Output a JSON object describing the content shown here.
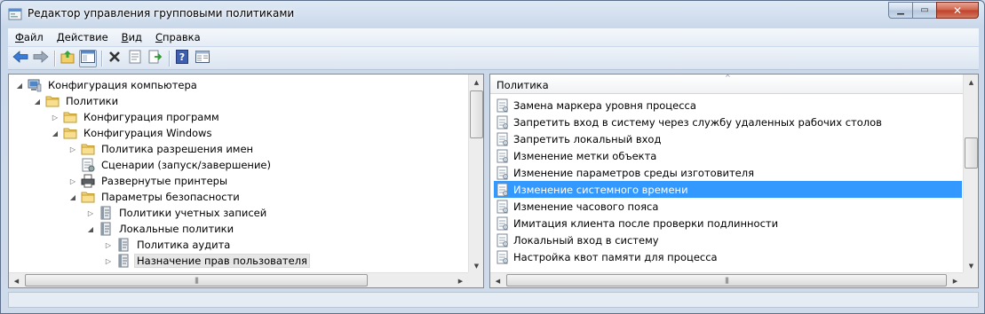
{
  "window": {
    "title": "Редактор управления групповыми политиками",
    "close_glyph": "✕",
    "min_glyph": "▁",
    "max_glyph": "▭"
  },
  "menu": [
    {
      "hotkey": "Ф",
      "rest": "айл"
    },
    {
      "hotkey": "Д",
      "rest": "ействие"
    },
    {
      "hotkey": "В",
      "rest": "ид"
    },
    {
      "hotkey": "С",
      "rest": "правка"
    }
  ],
  "toolbar": {
    "icons": [
      "back-arrow-icon",
      "forward-arrow-icon",
      "up-folder-icon",
      "show-hide-tree-icon",
      "delete-icon",
      "properties-icon",
      "export-list-icon",
      "help-icon",
      "console-view-icon"
    ]
  },
  "tree": {
    "items": [
      {
        "label": "Конфигурация компьютера",
        "twisty": "◢",
        "icon": "computer-icon"
      },
      {
        "label": "Политики",
        "twisty": "◢",
        "icon": "folder-icon"
      },
      {
        "label": "Конфигурация программ",
        "twisty": "▷",
        "icon": "folder-icon"
      },
      {
        "label": "Конфигурация Windows",
        "twisty": "◢",
        "icon": "folder-icon"
      },
      {
        "label": "Политика разрешения имен",
        "twisty": "▷",
        "icon": "folder-icon"
      },
      {
        "label": "Сценарии (запуск/завершение)",
        "twisty": "",
        "icon": "script-icon"
      },
      {
        "label": "Развернутые принтеры",
        "twisty": "▷",
        "icon": "printer-icon"
      },
      {
        "label": "Параметры безопасности",
        "twisty": "◢",
        "icon": "security-settings-icon"
      },
      {
        "label": "Политики учетных записей",
        "twisty": "▷",
        "icon": "policy-book-icon"
      },
      {
        "label": "Локальные политики",
        "twisty": "◢",
        "icon": "policy-book-icon"
      },
      {
        "label": "Политика аудита",
        "twisty": "▷",
        "icon": "policy-book-icon"
      },
      {
        "label": "Назначение прав пользователя",
        "twisty": "▷",
        "icon": "policy-book-icon"
      }
    ]
  },
  "list": {
    "column_header": "Политика",
    "sort_glyph": "^",
    "rows": [
      {
        "label": "Замена маркера уровня процесса"
      },
      {
        "label": "Запретить вход в систему через службу удаленных рабочих столов"
      },
      {
        "label": "Запретить локальный вход"
      },
      {
        "label": "Изменение метки объекта"
      },
      {
        "label": "Изменение параметров среды изготовителя"
      },
      {
        "label": "Изменение системного времени"
      },
      {
        "label": "Изменение часового пояса"
      },
      {
        "label": "Имитация клиента после проверки подлинности"
      },
      {
        "label": "Локальный вход в систему"
      },
      {
        "label": "Настройка квот памяти для процесса"
      }
    ],
    "selected_label": "Изменение системного времени"
  },
  "scroll": {
    "up": "▲",
    "down": "▼",
    "left": "◀",
    "right": "▶",
    "grip": "|||"
  },
  "colors": {
    "selection": "#3399ff",
    "tree_selection": "#e6e6e6"
  }
}
